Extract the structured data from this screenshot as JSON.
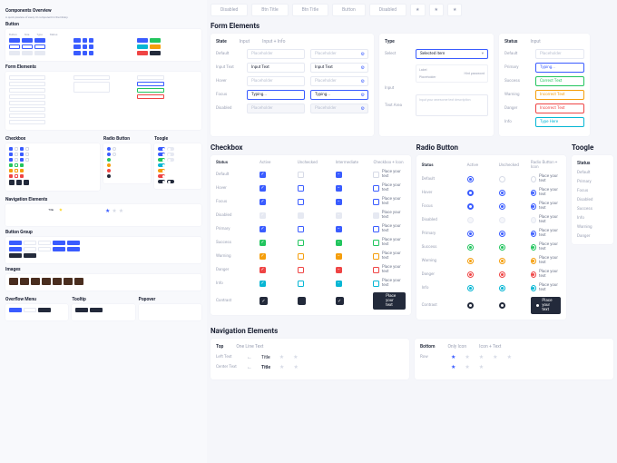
{
  "sidebar": {
    "page_title": "Components Overview",
    "page_sub": "A quick preview of every UI component in the library.",
    "sections": {
      "button": "Button",
      "form": "Form Elements",
      "checkbox": "Checkbox",
      "radio": "Radio Button",
      "toggle": "Toogle",
      "nav": "Navigation Elements",
      "btn_group": "Button Group",
      "images": "Images",
      "overflow": "Overflow Menu",
      "tooltip": "Tooltip",
      "popover": "Popover"
    }
  },
  "top_tabs": [
    "Disabled",
    "Btn Title",
    "Btn Title",
    "Button",
    "Disabled"
  ],
  "form": {
    "title": "Form Elements",
    "state_card": {
      "head": [
        "State",
        "Input",
        "Input + Info"
      ],
      "rows": {
        "default": "Default",
        "input_text": "Input Text",
        "hover": "Hover",
        "focus": "Focus",
        "disabled": "Disabled"
      },
      "placeholder": "Placeholder",
      "value": "Input Text",
      "typing": "Typing..."
    },
    "type_card": {
      "head": [
        "Type"
      ],
      "select_label": "Select",
      "selected": "Selected item",
      "input_label": "Input",
      "input_ph": "Placeholder",
      "textarea_label": "Text Area",
      "textarea_ph": "Input your awesome text description",
      "dropdown": {
        "label": "Label",
        "hint": "Hint password"
      }
    },
    "status_card": {
      "head": [
        "Status",
        "Input"
      ],
      "rows": [
        {
          "label": "Default",
          "text": "Placeholder",
          "cls": "st-default"
        },
        {
          "label": "Primary",
          "text": "Typing...",
          "cls": "st-primary"
        },
        {
          "label": "Success",
          "text": "Correct Text",
          "cls": "st-success"
        },
        {
          "label": "Warning",
          "text": "Incorrect Text",
          "cls": "st-warning"
        },
        {
          "label": "Danger",
          "text": "Incorrect Text",
          "cls": "st-danger"
        },
        {
          "label": "Info",
          "text": "Type Here",
          "cls": "st-info"
        }
      ]
    }
  },
  "checkbox": {
    "title": "Checkbox",
    "head": [
      "Status",
      "Active",
      "Unchecked",
      "Intermediate",
      "Checkbox + Icon"
    ],
    "rows": [
      "Default",
      "Hover",
      "Focus",
      "Disabled",
      "Primary",
      "Success",
      "Warning",
      "Danger",
      "Info",
      "Contrast"
    ],
    "label_text": "Place your text"
  },
  "radio": {
    "title": "Radio Button",
    "head": [
      "Status",
      "Active",
      "Unchecked",
      "Radio Button + Icon"
    ],
    "rows": [
      "Default",
      "Hover",
      "Focus",
      "Disabled",
      "Primary",
      "Success",
      "Warning",
      "Danger",
      "Info",
      "Contrast"
    ],
    "label_text": "Place your text"
  },
  "toggle": {
    "title": "Toogle",
    "head": [
      "Status"
    ],
    "rows": [
      "Default",
      "Primary",
      "Focus",
      "Disabled",
      "Success",
      "Info",
      "Warning",
      "Danger"
    ]
  },
  "nav": {
    "title": "Navigation Elements",
    "top": {
      "head": [
        "Top",
        "One Line Text"
      ],
      "left": "Left Text",
      "center": "Center Text",
      "title": "Title"
    },
    "bottom": {
      "head": [
        "Bottom",
        "Only Icon",
        "Icon + Text"
      ],
      "row": "Row"
    }
  }
}
